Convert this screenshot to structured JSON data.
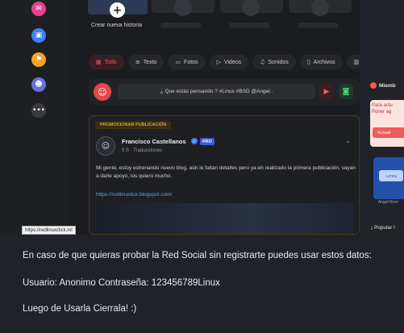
{
  "sidebar": {
    "icons": [
      {
        "name": "megaphone-icon",
        "glyph": "✉",
        "color": "#e0458e"
      },
      {
        "name": "box-icon",
        "glyph": "▣",
        "color": "#3b82f6"
      },
      {
        "name": "flag-icon",
        "glyph": "⚑",
        "color": "#f2a42a"
      },
      {
        "name": "groups-icon",
        "glyph": "☻",
        "color": "#6c6fd6"
      },
      {
        "name": "more-icon",
        "glyph": "•••",
        "color": "#3a3b40"
      }
    ]
  },
  "stories": {
    "create_label": "Crear nueva historia",
    "plus_glyph": "+"
  },
  "tabs": [
    {
      "icon": "▦",
      "label": "Todo",
      "active": true
    },
    {
      "icon": "≡",
      "label": "Texto",
      "active": false
    },
    {
      "icon": "▭",
      "label": "Fotos",
      "active": false
    },
    {
      "icon": "▷",
      "label": "Videos",
      "active": false
    },
    {
      "icon": "♫",
      "label": "Sonidos",
      "active": false
    },
    {
      "icon": "▯",
      "label": "Archivos",
      "active": false
    },
    {
      "icon": "▥",
      "label": "Mapas",
      "active": false
    }
  ],
  "composer": {
    "avatar_glyph": "☺",
    "placeholder": "¿ Que estás pensando ? #Linux #BSD @Angel..",
    "video_glyph": "▶",
    "photo_glyph": "◙"
  },
  "post": {
    "badge": "PROMOCIONAR PUBLICACIÓN",
    "author_glyph": "☺",
    "author": "Francisco Castellanos",
    "verified_glyph": "✓",
    "pro": "PRO",
    "meta": "5 S · Traducciones",
    "chevron_glyph": "⌄",
    "text": "Mi gente, estoy estrenando nuevo blog, aún le faltan detalles pero ya eh realizado la primera publicación, vayan a darle apoyo, los quiero mucho.",
    "link": "https://notilinuxtux.blogspot.com/"
  },
  "status_url": "https://redlinuxclick.ml",
  "right": {
    "card_title": "Miemb",
    "card_text_1": "Para actu",
    "card_text_2": "Poner ag",
    "card_button": "Actuali",
    "thumb_text": "AJTEN",
    "thumb_label": "Angel Rom",
    "popular": "¡ Popular !"
  },
  "captions": {
    "line1": "En caso de que quieras probar la Red Social sin registrarte puedes usar estos datos:",
    "line2": "Usuario: Anonimo Contraseña: 123456789Linux",
    "line3": "Luego de Usarla Cierrala! :)"
  }
}
